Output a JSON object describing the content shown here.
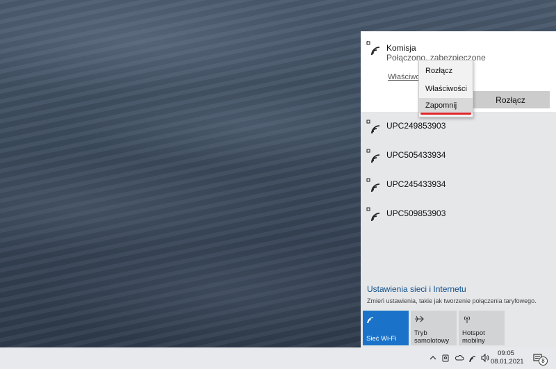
{
  "networks": {
    "connected": {
      "name": "Komisja",
      "status": "Połączono, zabezpieczone",
      "properties_link": "Właściwości",
      "disconnect_button": "Rozłącz",
      "icon": "wifi-secured-icon"
    },
    "list": [
      {
        "name": "UPC249853903",
        "icon": "wifi-secured-icon"
      },
      {
        "name": "UPC505433934",
        "icon": "wifi-secured-icon"
      },
      {
        "name": "UPC245433934",
        "icon": "wifi-secured-icon"
      },
      {
        "name": "UPC509853903",
        "icon": "wifi-secured-icon"
      }
    ]
  },
  "context_menu": {
    "items": [
      {
        "label": "Rozłącz"
      },
      {
        "label": "Właściwości"
      },
      {
        "label": "Zapomnij",
        "highlighted": true
      }
    ]
  },
  "settings": {
    "link": "Ustawienia sieci i Internetu",
    "description": "Zmień ustawienia, takie jak tworzenie połączenia taryfowego."
  },
  "quick_actions": [
    {
      "label_line1": "Sieć Wi-Fi",
      "label_line2": "",
      "icon": "wifi-icon",
      "active": true
    },
    {
      "label_line1": "Tryb",
      "label_line2": "samolotowy",
      "icon": "airplane-icon",
      "active": false
    },
    {
      "label_line1": "Hotspot",
      "label_line2": "mobilny",
      "icon": "hotspot-icon",
      "active": false
    }
  ],
  "taskbar": {
    "time": "09:05",
    "date": "08.01.2021",
    "notification_count": "8"
  },
  "colors": {
    "accent": "#1a73c9",
    "link": "#0f4f8a",
    "highlight_mark": "#e2262b"
  }
}
